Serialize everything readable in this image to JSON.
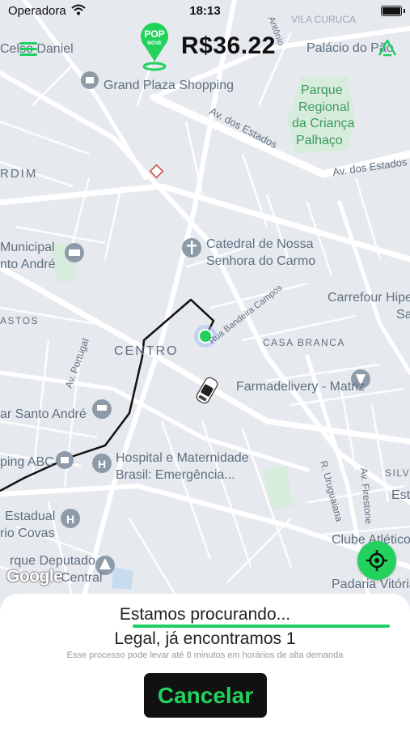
{
  "status_bar": {
    "carrier": "Operadora",
    "time": "18:13"
  },
  "header": {
    "logo_text_top": "POP",
    "logo_text_bottom": "MOVE",
    "fare": "R$36.22"
  },
  "map": {
    "labels": [
      "Celso Daniel",
      "VILA CURUCA",
      "Palácio do Pão",
      "Grand Plaza Shopping",
      "Parque",
      "Regional",
      "da Criança",
      "Palhaço",
      "Av. dos Estados",
      "Av. dos Estados",
      "RDIM",
      "Catedral de Nossa",
      "Senhora do Carmo",
      "Municipal",
      "nto André",
      "Carrefour Hipe",
      "Sa",
      "ASTOS",
      "CENTRO",
      "CASA BRANCA",
      "Av. Portugal",
      "Farmadelivery - Matriz",
      "ar Santo André",
      "Hospital e Maternidade",
      "Brasil: Emergência...",
      "ping ABC",
      "R. Uruguaiana",
      "Av. Firestone",
      "SILVE",
      "Est",
      "Estadual",
      "rio Covas",
      "Clube Atlético",
      "rque Deputado",
      "Central",
      "Padaria Vitória",
      "Rua Bandeira Campos",
      "Antônio"
    ],
    "attribution": "Google"
  },
  "sheet": {
    "searching": "Estamos procurando...",
    "found": "Legal, já encontramos 1",
    "note": "Esse processo pode levar até 8 minutos em horários de alta demanda",
    "cancel_label": "Cancelar"
  },
  "colors": {
    "accent": "#1ecf63",
    "button_bg": "#111111",
    "map_bg": "#e8ecef",
    "road": "#ffffff",
    "label": "#5f6f80"
  }
}
